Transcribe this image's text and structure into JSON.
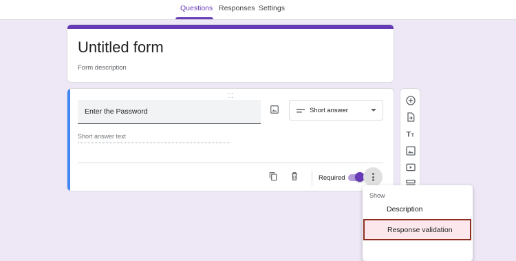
{
  "tabs": [
    {
      "label": "Questions",
      "active": true
    },
    {
      "label": "Responses",
      "active": false
    },
    {
      "label": "Settings",
      "active": false
    }
  ],
  "form": {
    "title": "Untitled form",
    "description": "Form description"
  },
  "question": {
    "text": "Enter the Password",
    "type_label": "Short answer",
    "answer_placeholder": "Short answer text",
    "required_label": "Required",
    "required_on": true
  },
  "side_tools": [
    "add-question-icon",
    "import-questions-icon",
    "add-title-icon",
    "add-image-icon",
    "add-video-icon",
    "add-section-icon"
  ],
  "menu": {
    "header": "Show",
    "items": [
      {
        "label": "Description",
        "highlighted": false
      },
      {
        "label": "Response validation",
        "highlighted": true
      }
    ]
  },
  "colors": {
    "accent": "#673ab7",
    "background": "#ede7f6",
    "question_accent": "#4285f4",
    "highlight_border": "#8b2e1f",
    "highlight_bg": "#fce8ec"
  }
}
